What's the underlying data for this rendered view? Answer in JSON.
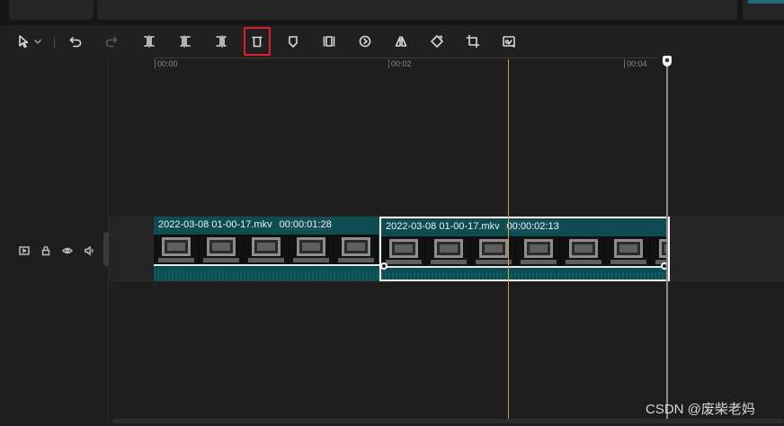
{
  "toolbar": {
    "items": [
      {
        "name": "select-tool",
        "icon": "cursor-icon"
      },
      {
        "name": "select-dropdown",
        "icon": "chevron-down-icon"
      },
      {
        "name": "undo",
        "icon": "undo-icon"
      },
      {
        "name": "redo",
        "icon": "redo-icon",
        "disabled": true
      },
      {
        "name": "split",
        "icon": "split-icon"
      },
      {
        "name": "split-left",
        "icon": "trim-left-icon"
      },
      {
        "name": "split-right",
        "icon": "trim-right-icon"
      },
      {
        "name": "delete",
        "icon": "delete-icon",
        "highlighted": true
      },
      {
        "name": "marker",
        "icon": "marker-icon"
      },
      {
        "name": "freeze-frame",
        "icon": "freeze-icon"
      },
      {
        "name": "reverse",
        "icon": "reverse-icon"
      },
      {
        "name": "mirror",
        "icon": "mirror-icon"
      },
      {
        "name": "rotate",
        "icon": "rotate-icon"
      },
      {
        "name": "crop",
        "icon": "crop-icon"
      },
      {
        "name": "smart-tools",
        "icon": "smart-cut-icon"
      }
    ],
    "highlight_color": "#e02020"
  },
  "ruler": {
    "labels": [
      "00:00",
      "00:02",
      "00:04"
    ]
  },
  "track": {
    "controls": [
      "thumbnail-icon",
      "lock-icon",
      "eye-icon",
      "speaker-icon"
    ],
    "cover_label": "封面"
  },
  "clips": [
    {
      "name": "2022-03-08 01-00-17.mkv",
      "duration": "00:00:01:28",
      "selected": false
    },
    {
      "name": "2022-03-08 01-00-17.mkv",
      "duration": "00:00:02:13",
      "selected": true
    }
  ],
  "colors": {
    "clip": "#0d4d52",
    "cursor": "#c9a43a",
    "playhead": "#f0f0f0"
  },
  "watermark": "CSDN @废柴老妈"
}
